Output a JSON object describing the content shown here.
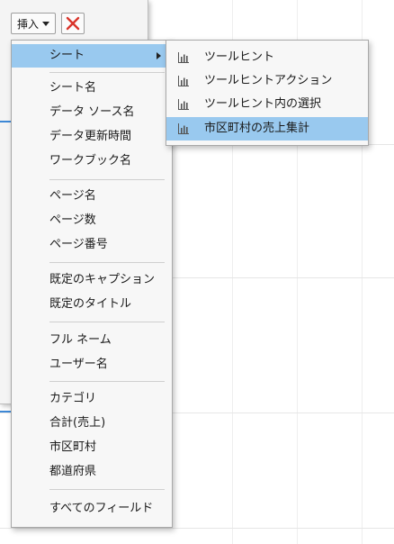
{
  "toolbar": {
    "insert_label": "挿入",
    "icons": {
      "insert_caret": "chevron-down-icon",
      "close": "close-icon"
    },
    "close_color": "#d9342b"
  },
  "menu": {
    "sheet_item": "シート",
    "group1": [
      "シート名",
      "データ ソース名",
      "データ更新時間",
      "ワークブック名"
    ],
    "group2": [
      "ページ名",
      "ページ数",
      "ページ番号"
    ],
    "group3": [
      "既定のキャプション",
      "既定のタイトル"
    ],
    "group4": [
      "フル ネーム",
      "ユーザー名"
    ],
    "group5": [
      "カテゴリ",
      "合計(売上)",
      "市区町村",
      "都道府県"
    ],
    "group6": [
      "すべてのフィールド"
    ]
  },
  "submenu": {
    "items": [
      "ツールヒント",
      "ツールヒントアクション",
      "ツールヒント内の選択",
      "市区町村の売上集計"
    ],
    "selected_index": 3,
    "icon": "sheet-chart-icon"
  },
  "colors": {
    "highlight": "#99c9ef",
    "accent_blue": "#3d88d6"
  }
}
